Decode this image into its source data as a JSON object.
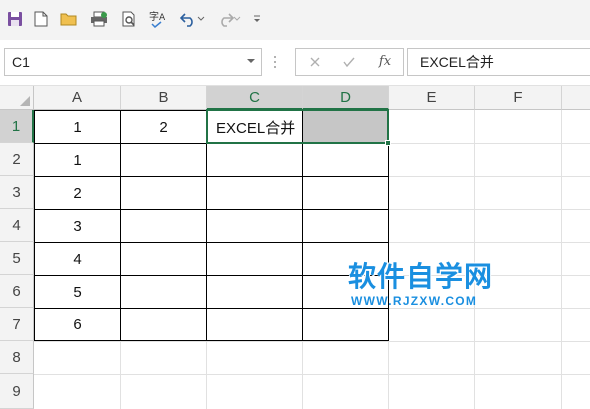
{
  "toolbar": {
    "icons": [
      "save-icon",
      "new-document-icon",
      "open-folder-icon",
      "print-icon",
      "print-preview-icon",
      "spelling-icon",
      "undo-icon",
      "redo-icon",
      "customize-toolbar-icon"
    ]
  },
  "formula_bar": {
    "name_box": "C1",
    "formula": "EXCEL合并",
    "fx_label": "fx"
  },
  "columns": [
    "A",
    "B",
    "C",
    "D",
    "E",
    "F"
  ],
  "rows": [
    "1",
    "2",
    "3",
    "4",
    "5",
    "6",
    "7",
    "8",
    "9"
  ],
  "cells": {
    "A1": "1",
    "B1": "2",
    "C1": "EXCEL合并",
    "A2": "1",
    "A3": "2",
    "A4": "3",
    "A5": "4",
    "A6": "5",
    "A7": "6"
  },
  "watermark": {
    "title": "软件自学网",
    "url": "WWW.RJZXW.COM"
  },
  "colors": {
    "accent_green": "#217346",
    "watermark_blue": "#1a8fe0",
    "selection_fill": "#c6c6c6"
  }
}
